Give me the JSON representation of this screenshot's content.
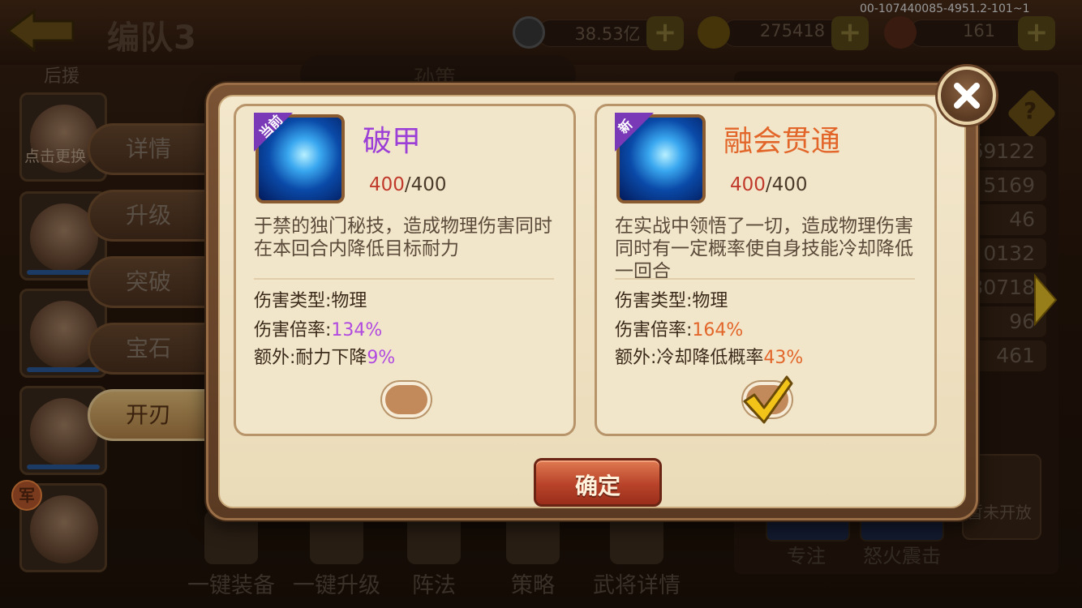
{
  "debug_id": "00-107440085-4951.2-101~1",
  "header": {
    "title": "编队3",
    "resources": [
      {
        "icon": "coin-icon",
        "value": "38.53亿"
      },
      {
        "icon": "gold-ingot-icon",
        "value": "275418"
      },
      {
        "icon": "meat-icon",
        "value": "161"
      }
    ]
  },
  "left_panel": {
    "support_label": "后援",
    "click_hint": "点击更换",
    "army_badge": "军"
  },
  "side_menu": {
    "items": [
      "详情",
      "升级",
      "突破",
      "宝石",
      "开刃"
    ],
    "active": "开刃"
  },
  "top_tab": {
    "label": "孙策"
  },
  "right_panel": {
    "stats": [
      "69122",
      "5169",
      "46",
      "0132",
      "30718",
      "96",
      "461"
    ],
    "locked_label": "暂未开放",
    "skills": [
      "专注",
      "怒火震击"
    ]
  },
  "bottom_bar": {
    "items": [
      "一键装备",
      "一键升级",
      "阵法",
      "策略",
      "武将详情"
    ]
  },
  "dialog": {
    "cards": [
      {
        "tag": "当前",
        "name": "破甲",
        "name_color": "#9b3fd6",
        "current": "400",
        "max": "/400",
        "description": "于禁的独门秘技，造成物理伤害同时在本回合内降低目标耐力",
        "damage_type": "伤害类型:物理",
        "damage_rate_label": "伤害倍率:",
        "damage_rate_value": "134%",
        "extra_label": "额外:耐力下降",
        "extra_value": "9%",
        "highlight_color": "#b04ae0",
        "selected": false
      },
      {
        "tag": "新",
        "name": "融会贯通",
        "name_color": "#e2662a",
        "current": "400",
        "max": "/400",
        "description": "在实战中领悟了一切，造成物理伤害同时有一定概率使自身技能冷却降低一回合",
        "damage_type": "伤害类型:物理",
        "damage_rate_label": "伤害倍率:",
        "damage_rate_value": "164%",
        "extra_label": "额外:冷却降低概率",
        "extra_value": "43%",
        "highlight_color": "#e2662a",
        "selected": true
      }
    ],
    "confirm_label": "确定"
  }
}
